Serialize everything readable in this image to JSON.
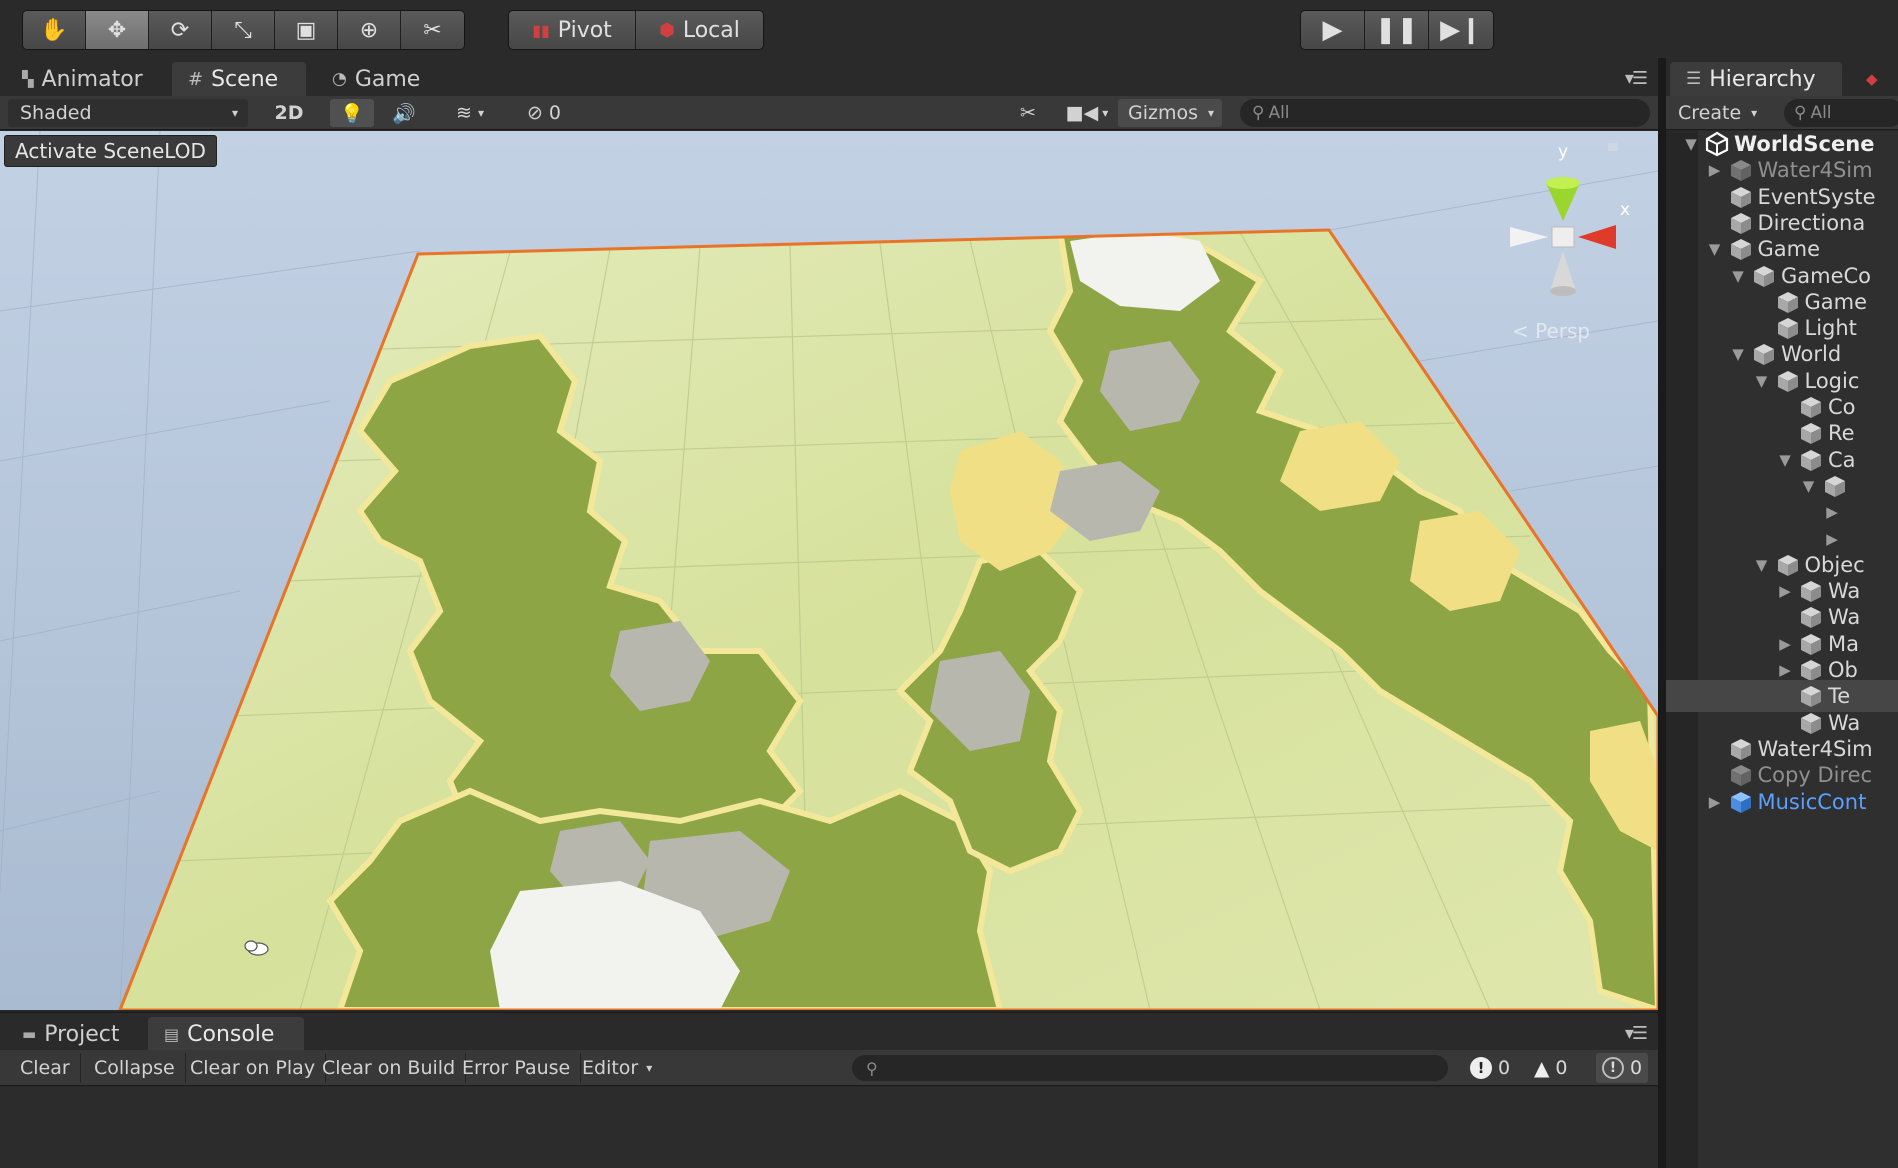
{
  "toolbar": {
    "transform_tools": [
      {
        "name": "hand-tool",
        "glyph": "✋"
      },
      {
        "name": "move-tool",
        "glyph": "✥"
      },
      {
        "name": "rotate-tool",
        "glyph": "⟳"
      },
      {
        "name": "scale-tool",
        "glyph": "⤡"
      },
      {
        "name": "rect-tool",
        "glyph": "▣"
      },
      {
        "name": "transform-tool",
        "glyph": "⊕"
      },
      {
        "name": "custom-tool",
        "glyph": "✂"
      }
    ],
    "pivot_label": "Pivot",
    "local_label": "Local"
  },
  "scene_panel": {
    "tabs": [
      {
        "label": "Animator",
        "icon": "animator-icon"
      },
      {
        "label": "Scene",
        "icon": "grid-icon"
      },
      {
        "label": "Game",
        "icon": "pacman-icon"
      }
    ],
    "shading_mode": "Shaded",
    "mode_2d": "2D",
    "hidden_count": "0",
    "gizmos_label": "Gizmos",
    "search_placeholder": "All",
    "scenelod_button": "Activate SceneLOD",
    "gizmo_labels": {
      "y": "y",
      "x": "x"
    },
    "projection_label": "Persp",
    "colors": {
      "sky": "#b4c4d8",
      "plane": "#d8e2a0",
      "grass": "#8ea545",
      "sand": "#f1df86",
      "rock": "#b7b7ad",
      "snow": "#f2f2ee",
      "selection_outline": "#e8742a"
    }
  },
  "console_panel": {
    "tabs": [
      {
        "label": "Project",
        "icon": "folder-icon"
      },
      {
        "label": "Console",
        "icon": "console-icon"
      }
    ],
    "buttons": [
      "Clear",
      "Collapse",
      "Clear on Play",
      "Clear on Build",
      "Error Pause",
      "Editor"
    ],
    "counts": {
      "info": "0",
      "warning": "0",
      "error": "0"
    }
  },
  "hierarchy": {
    "tab_label": "Hierarchy",
    "create_label": "Create",
    "search_placeholder": "All",
    "items": [
      {
        "label": "WorldScene",
        "depth": 0,
        "arrow": "open",
        "type": "scene"
      },
      {
        "label": "Water4Sim",
        "depth": 1,
        "arrow": "closed",
        "type": "dim"
      },
      {
        "label": "EventSyste",
        "depth": 1,
        "arrow": "none",
        "type": "normal"
      },
      {
        "label": "Directiona",
        "depth": 1,
        "arrow": "none",
        "type": "normal"
      },
      {
        "label": "Game",
        "depth": 1,
        "arrow": "open",
        "type": "normal"
      },
      {
        "label": "GameCo",
        "depth": 2,
        "arrow": "open",
        "type": "normal"
      },
      {
        "label": "Game",
        "depth": 3,
        "arrow": "none",
        "type": "normal"
      },
      {
        "label": "Light",
        "depth": 3,
        "arrow": "none",
        "type": "normal"
      },
      {
        "label": "World",
        "depth": 2,
        "arrow": "open",
        "type": "normal"
      },
      {
        "label": "Logic",
        "depth": 3,
        "arrow": "open",
        "type": "normal"
      },
      {
        "label": "Co",
        "depth": 4,
        "arrow": "none",
        "type": "normal"
      },
      {
        "label": "Re",
        "depth": 4,
        "arrow": "none",
        "type": "normal"
      },
      {
        "label": "Ca",
        "depth": 4,
        "arrow": "open",
        "type": "normal"
      },
      {
        "label": "",
        "depth": 5,
        "arrow": "open",
        "type": "normal"
      },
      {
        "label": "",
        "depth": 6,
        "arrow": "closed",
        "type": "none"
      },
      {
        "label": "",
        "depth": 6,
        "arrow": "closed",
        "type": "none"
      },
      {
        "label": "Objec",
        "depth": 3,
        "arrow": "open",
        "type": "normal"
      },
      {
        "label": "Wa",
        "depth": 4,
        "arrow": "closed",
        "type": "normal"
      },
      {
        "label": "Wa",
        "depth": 4,
        "arrow": "none",
        "type": "normal"
      },
      {
        "label": "Ma",
        "depth": 4,
        "arrow": "closed",
        "type": "normal"
      },
      {
        "label": "Ob",
        "depth": 4,
        "arrow": "closed",
        "type": "normal"
      },
      {
        "label": "Te",
        "depth": 4,
        "arrow": "none",
        "type": "selected"
      },
      {
        "label": "Wa",
        "depth": 4,
        "arrow": "none",
        "type": "normal"
      },
      {
        "label": "Water4Sim",
        "depth": 1,
        "arrow": "none",
        "type": "normal"
      },
      {
        "label": "Copy Direc",
        "depth": 1,
        "arrow": "none",
        "type": "dim"
      },
      {
        "label": "MusicCont",
        "depth": 1,
        "arrow": "closed",
        "type": "prefab"
      }
    ]
  }
}
